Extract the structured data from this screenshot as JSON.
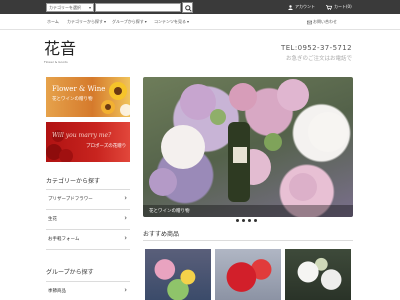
{
  "topbar": {
    "category_select": "カテゴリーを選択",
    "search_placeholder": "",
    "account": "アカウント",
    "cart": "カート(0)"
  },
  "nav": {
    "home": "ホーム",
    "category": "カテゴリーから探す",
    "group": "グループから探す",
    "contents": "コンテンツを見る",
    "contact": "お問い合わせ"
  },
  "logo": {
    "mark": "花音",
    "sub": "Flower & Goods"
  },
  "header": {
    "tel": "TEL:0952-37-5712",
    "tel_note": "お急ぎのご注文はお電話で"
  },
  "banners": [
    {
      "title": "Flower & Wine",
      "sub": "花とワインの贈り物"
    },
    {
      "title": "Will you marry me?",
      "sub": "プロポーズの花贈り"
    }
  ],
  "sidebar": {
    "category_heading": "カテゴリーから探す",
    "category_items": [
      {
        "label": "プリザーブドフラワー"
      },
      {
        "label": "生花"
      },
      {
        "label": "お手軽フォーム"
      }
    ],
    "group_heading": "グループから探す",
    "group_items": [
      {
        "label": "季節商品"
      }
    ]
  },
  "hero": {
    "caption": "花とワインの贈り物",
    "slide_count": 4,
    "active_slide": 1
  },
  "recommended": {
    "heading": "おすすめ商品"
  },
  "colors": {
    "topbar": "#3a3a3a",
    "accent": "#333333"
  }
}
